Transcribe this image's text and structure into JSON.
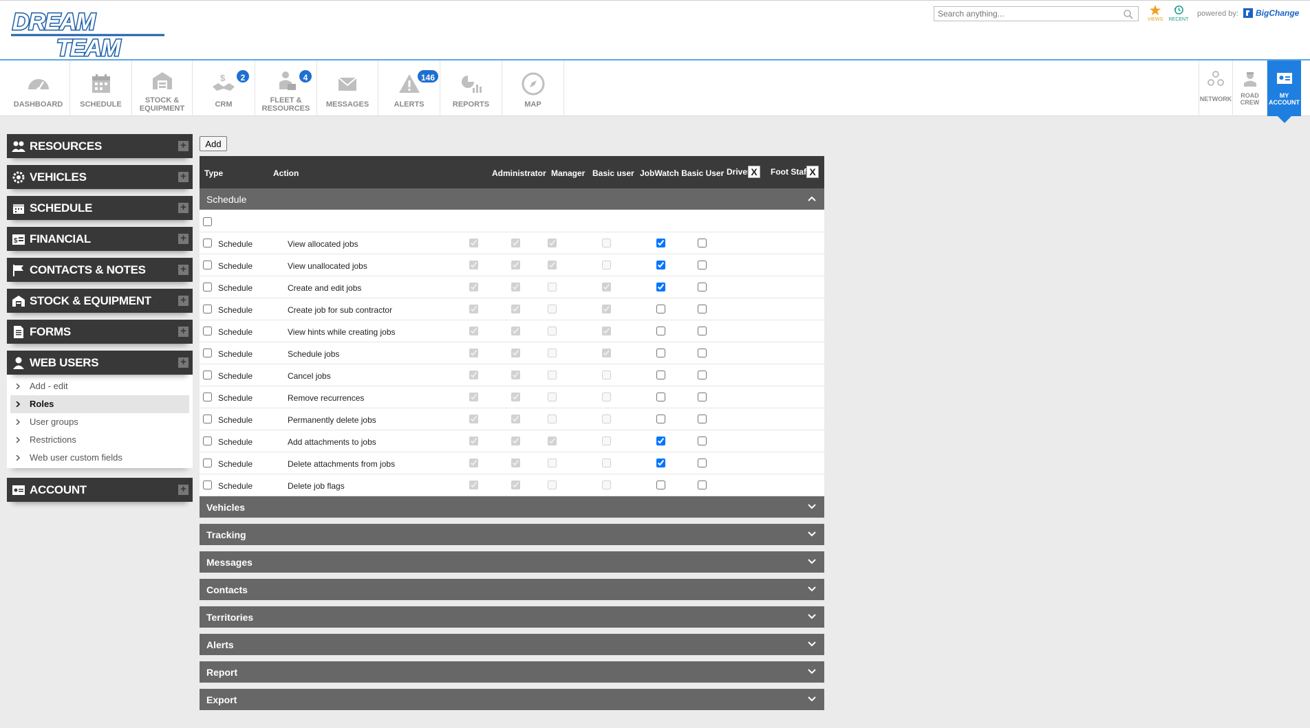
{
  "header": {
    "logo_text_line1": "DREAM",
    "logo_text_line2": "TEAM",
    "search_placeholder": "Search anything...",
    "views_label": "VIEWS",
    "recent_label": "RECENT",
    "powered_by": "powered by:",
    "brand": "BigChange"
  },
  "nav": {
    "items": [
      {
        "label": "DASHBOARD",
        "icon": "speedometer-icon"
      },
      {
        "label": "SCHEDULE",
        "icon": "calendar-icon"
      },
      {
        "label_1": "STOCK &",
        "label_2": "EQUIPMENT",
        "icon": "warehouse-icon"
      },
      {
        "label": "CRM",
        "icon": "handshake-icon",
        "badge": "2"
      },
      {
        "label_1": "FLEET &",
        "label_2": "RESOURCES",
        "icon": "worker-icon",
        "badge": "4"
      },
      {
        "label": "MESSAGES",
        "icon": "envelope-icon"
      },
      {
        "label": "ALERTS",
        "icon": "warning-icon",
        "badge": "146"
      },
      {
        "label": "REPORTS",
        "icon": "chart-icon"
      },
      {
        "label": "MAP",
        "icon": "compass-icon"
      }
    ],
    "right": [
      {
        "label": "NETWORK",
        "icon": "network-icon"
      },
      {
        "label_1": "ROAD",
        "label_2": "CREW",
        "icon": "road-crew-icon"
      },
      {
        "label_1": "MY",
        "label_2": "ACCOUNT",
        "icon": "id-card-icon"
      }
    ]
  },
  "sidebar": {
    "sections": [
      {
        "label": "RESOURCES"
      },
      {
        "label": "VEHICLES"
      },
      {
        "label": "SCHEDULE"
      },
      {
        "label": "FINANCIAL"
      },
      {
        "label": "CONTACTS & NOTES"
      },
      {
        "label": "STOCK & EQUIPMENT"
      },
      {
        "label": "FORMS"
      },
      {
        "label": "WEB USERS"
      },
      {
        "label": "ACCOUNT"
      }
    ],
    "web_users_items": [
      "Add - edit",
      "Roles",
      "User groups",
      "Restrictions",
      "Web user custom fields"
    ],
    "active_item": "Roles"
  },
  "toolbar": {
    "add_label": "Add"
  },
  "table": {
    "columns": [
      "Type",
      "Action",
      "Administrator",
      "Manager",
      "Basic user",
      "JobWatch Basic User",
      "Driver",
      "Foot Staff"
    ],
    "remove_column_label": "X",
    "open_group": "Schedule",
    "rows": [
      {
        "type": "Schedule",
        "action": "View allocated jobs",
        "admin": true,
        "manager": true,
        "basic": true,
        "jobwatch": false,
        "driver": true,
        "foot": false
      },
      {
        "type": "Schedule",
        "action": "View unallocated jobs",
        "admin": true,
        "manager": true,
        "basic": true,
        "jobwatch": false,
        "driver": true,
        "foot": false
      },
      {
        "type": "Schedule",
        "action": "Create and edit jobs",
        "admin": true,
        "manager": true,
        "basic": false,
        "jobwatch": true,
        "driver": true,
        "foot": false
      },
      {
        "type": "Schedule",
        "action": "Create job for sub contractor",
        "admin": true,
        "manager": true,
        "basic": false,
        "jobwatch": true,
        "driver": false,
        "foot": false
      },
      {
        "type": "Schedule",
        "action": "View hints while creating jobs",
        "admin": true,
        "manager": true,
        "basic": false,
        "jobwatch": true,
        "driver": false,
        "foot": false
      },
      {
        "type": "Schedule",
        "action": "Schedule jobs",
        "admin": true,
        "manager": true,
        "basic": false,
        "jobwatch": true,
        "driver": false,
        "foot": false
      },
      {
        "type": "Schedule",
        "action": "Cancel jobs",
        "admin": true,
        "manager": true,
        "basic": false,
        "jobwatch": false,
        "driver": false,
        "foot": false
      },
      {
        "type": "Schedule",
        "action": "Remove recurrences",
        "admin": true,
        "manager": true,
        "basic": false,
        "jobwatch": false,
        "driver": false,
        "foot": false
      },
      {
        "type": "Schedule",
        "action": "Permanently delete jobs",
        "admin": true,
        "manager": true,
        "basic": false,
        "jobwatch": false,
        "driver": false,
        "foot": false
      },
      {
        "type": "Schedule",
        "action": "Add attachments to jobs",
        "admin": true,
        "manager": true,
        "basic": true,
        "jobwatch": false,
        "driver": true,
        "foot": false
      },
      {
        "type": "Schedule",
        "action": "Delete attachments from jobs",
        "admin": true,
        "manager": true,
        "basic": false,
        "jobwatch": false,
        "driver": true,
        "foot": false
      },
      {
        "type": "Schedule",
        "action": "Delete job flags",
        "admin": true,
        "manager": true,
        "basic": false,
        "jobwatch": false,
        "driver": false,
        "foot": false
      }
    ],
    "collapsed_groups": [
      "Vehicles",
      "Tracking",
      "Messages",
      "Contacts",
      "Territories",
      "Alerts",
      "Report",
      "Export"
    ]
  },
  "colors": {
    "accent": "#1f7fe0",
    "badge": "#1f6fd0",
    "dark_header": "#383838",
    "group_header": "#676767"
  }
}
